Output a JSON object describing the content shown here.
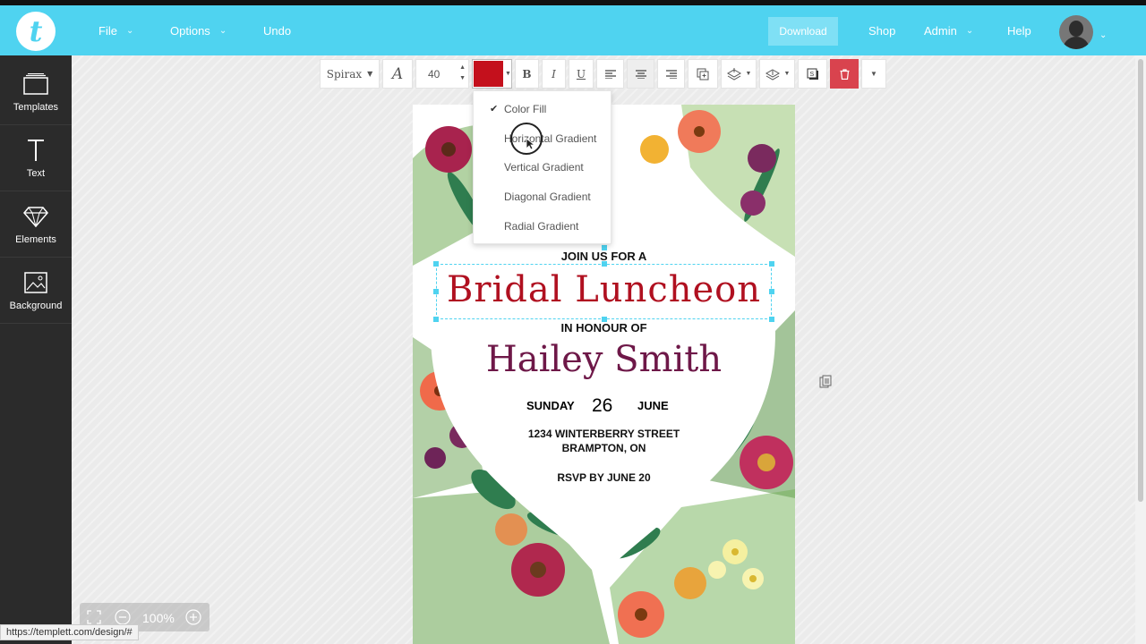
{
  "app": {
    "logo_letter": "t"
  },
  "nav": {
    "file": "File",
    "options": "Options",
    "undo": "Undo",
    "download": "Download",
    "shop": "Shop",
    "admin": "Admin",
    "help": "Help"
  },
  "sidebar": {
    "items": [
      {
        "label": "Templates",
        "icon": "templates-icon"
      },
      {
        "label": "Text",
        "icon": "text-icon"
      },
      {
        "label": "Elements",
        "icon": "diamond-icon"
      },
      {
        "label": "Background",
        "icon": "image-icon"
      }
    ]
  },
  "toolbar": {
    "font_name": "Spirax",
    "font_size": "40",
    "color": "#c4101c",
    "bold": "B",
    "italic": "I",
    "underline": "U"
  },
  "color_menu": {
    "items": [
      "Color Fill",
      "Horizontal Gradient",
      "Vertical Gradient",
      "Diagonal Gradient",
      "Radial Gradient"
    ],
    "selected": "Color Fill"
  },
  "invitation": {
    "intro": "JOIN US FOR A",
    "title": "Bridal Luncheon",
    "honour": "IN HONOUR OF",
    "name": "Hailey Smith",
    "day": "SUNDAY",
    "date": "26",
    "month": "JUNE",
    "address_line1": "1234 WINTERBERRY STREET",
    "address_line2": "BRAMPTON, ON",
    "rsvp": "RSVP BY JUNE 20"
  },
  "zoom": {
    "level": "100%"
  },
  "status": {
    "url": "https://templett.com/design/#"
  },
  "colors": {
    "accent": "#4fd3f0",
    "title_red": "#b01020",
    "name_purple": "#6e1848",
    "delete": "#d9434e"
  }
}
